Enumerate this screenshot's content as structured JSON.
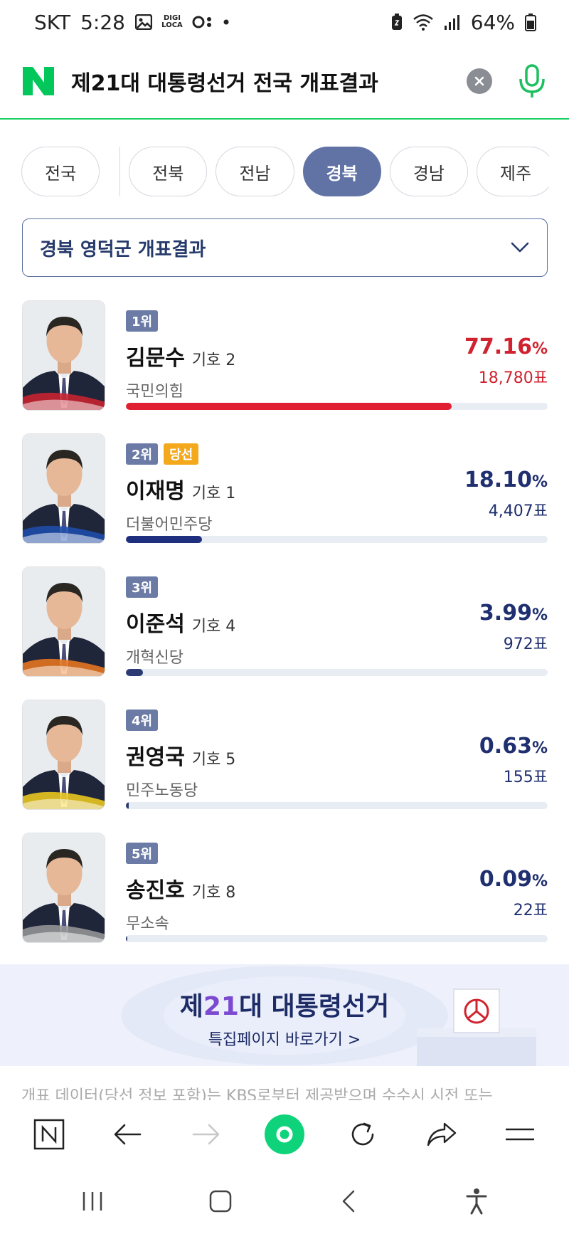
{
  "status": {
    "carrier": "SKT",
    "time": "5:28",
    "battery": "64%",
    "digi_text": "DIGI LOCA"
  },
  "search": {
    "query": "제21대 대통령선거 전국 개표결과",
    "logo": "N",
    "clear_icon": "close-icon",
    "mic_icon": "microphone-icon"
  },
  "region_tabs": [
    {
      "label": "전국",
      "active": false
    },
    {
      "label": "전북",
      "active": false
    },
    {
      "label": "전남",
      "active": false
    },
    {
      "label": "경북",
      "active": true
    },
    {
      "label": "경남",
      "active": false
    },
    {
      "label": "제주",
      "active": false
    }
  ],
  "district": {
    "label": "경북 영덕군 개표결과"
  },
  "candidates": [
    {
      "rank": "1위",
      "elected": "",
      "name": "김문수",
      "number": "기호 2",
      "party": "국민의힘",
      "percent": "77.16",
      "pct_unit": "%",
      "votes": "18,780표",
      "share": 0.7716,
      "color": "#d0232f",
      "bar_color": "#e02030",
      "ribbon": "#d0232f"
    },
    {
      "rank": "2위",
      "elected": "당선",
      "name": "이재명",
      "number": "기호 1",
      "party": "더불어민주당",
      "percent": "18.10",
      "pct_unit": "%",
      "votes": "4,407표",
      "share": 0.181,
      "color": "#1f2f6f",
      "bar_color": "#1f2f80",
      "ribbon": "#1f4fb0"
    },
    {
      "rank": "3위",
      "elected": "",
      "name": "이준석",
      "number": "기호 4",
      "party": "개혁신당",
      "percent": "3.99",
      "pct_unit": "%",
      "votes": "972표",
      "share": 0.0399,
      "color": "#1f2f6f",
      "bar_color": "#2b3a72",
      "ribbon": "#f07a20"
    },
    {
      "rank": "4위",
      "elected": "",
      "name": "권영국",
      "number": "기호 5",
      "party": "민주노동당",
      "percent": "0.63",
      "pct_unit": "%",
      "votes": "155표",
      "share": 0.0063,
      "color": "#1f2f6f",
      "bar_color": "#2b3a72",
      "ribbon": "#f5d020"
    },
    {
      "rank": "5위",
      "elected": "",
      "name": "송진호",
      "number": "기호 8",
      "party": "무소속",
      "percent": "0.09",
      "pct_unit": "%",
      "votes": "22표",
      "share": 0.0009,
      "color": "#1f2f6f",
      "bar_color": "#2b3a72",
      "ribbon": "#9a9a9a"
    }
  ],
  "banner": {
    "title_prefix": "제",
    "title_num": "21",
    "title_suffix": "대 대통령선거",
    "link": "특집페이지 바로가기 >"
  },
  "disclaimer": "개표 데이터(당선 정보 포함)는 KBS로부터 제공받으며 수수시 시전 또는"
}
